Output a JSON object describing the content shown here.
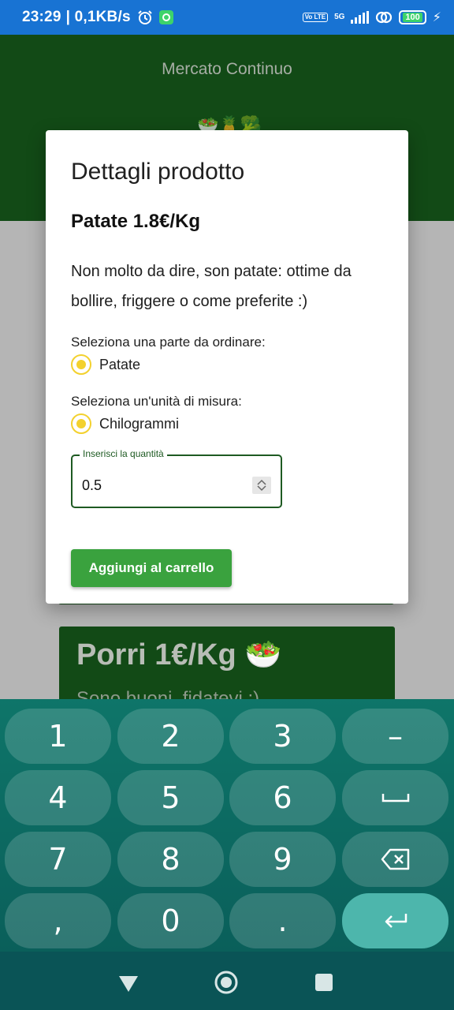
{
  "status_bar": {
    "time": "23:29",
    "network_speed": "| 0,1KB/s",
    "battery": "100",
    "network": "5G",
    "volte": "Vo LTE",
    "icons": [
      "alarm-icon",
      "notification-icon",
      "volte-icon",
      "signal-icon",
      "link-icon",
      "battery-icon",
      "charging-icon"
    ]
  },
  "app": {
    "title": "Mercato Continuo",
    "header_emoji": "🥗🍍🥦"
  },
  "background_card": {
    "title": "Porri 1€/Kg 🥗",
    "description": "Sono buoni, fidatevi :)"
  },
  "dialog": {
    "title": "Dettagli prodotto",
    "product": "Patate 1.8€/Kg",
    "description": "Non molto da dire, son patate: ottime da bollire, friggere o come preferite :)",
    "part_label": "Seleziona una parte da ordinare:",
    "part_option": "Patate",
    "unit_label": "Seleziona un'unità di misura:",
    "unit_option": "Chilogrammi",
    "quantity_label": "Inserisci la quantità",
    "quantity_value": "0.5",
    "add_button": "Aggiungi al carrello"
  },
  "keyboard": {
    "keys": [
      [
        "1",
        "2",
        "3",
        "–"
      ],
      [
        "4",
        "5",
        "6",
        "␣"
      ],
      [
        "7",
        "8",
        "9",
        "backspace"
      ],
      [
        ",",
        "0",
        ".",
        "enter"
      ]
    ],
    "enter_color": "#4db6ac"
  },
  "nav_bar": {
    "buttons": [
      "back-icon",
      "home-icon",
      "recents-icon"
    ]
  },
  "colors": {
    "status_bar": "#1873d3",
    "app_header": "#124a16",
    "accent_green": "#3aa23e",
    "radio_yellow": "#f3d12e",
    "keyboard": "#0e7569"
  }
}
